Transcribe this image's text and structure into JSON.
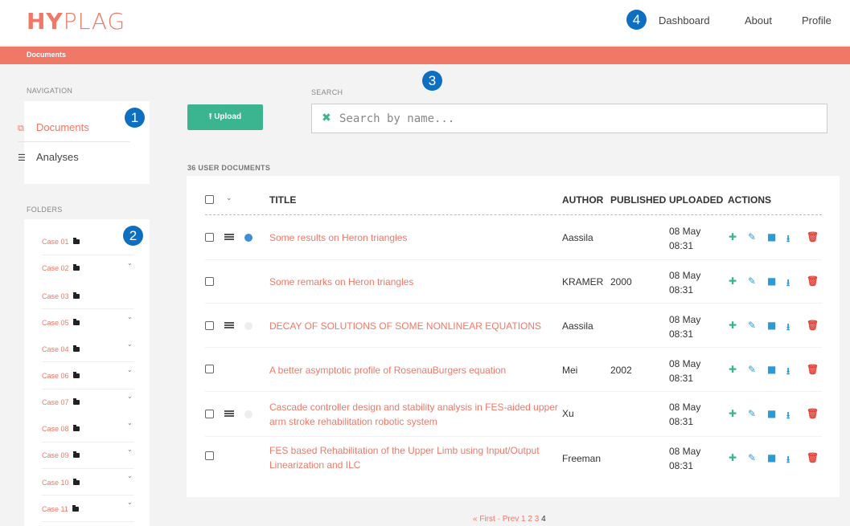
{
  "header": {
    "logo_bold": "HY",
    "logo_light": "PLAG",
    "nav": [
      "Dashboard",
      "About",
      "Profile"
    ]
  },
  "breadcrumb": "Documents",
  "badges": [
    "1",
    "2",
    "3",
    "4"
  ],
  "labels": {
    "navigation": "NAVIGATION",
    "search": "SEARCH",
    "folders": "FOLDERS",
    "doc_count": "36 USER DOCUMENTS"
  },
  "sidebar": {
    "items": [
      {
        "label": "Documents",
        "icon": "documents-icon"
      },
      {
        "label": "Analyses",
        "icon": "list-icon"
      }
    ]
  },
  "folders": [
    "Case 01",
    "Case 02",
    "Case 03",
    "Case 05",
    "Case 04",
    "Case 06",
    "Case 07",
    "Case 08",
    "Case 09",
    "Case 10",
    "Case 11"
  ],
  "toolbar": {
    "upload_label": "Upload",
    "search_placeholder": "Search by name..."
  },
  "table": {
    "headers": [
      "TITLE",
      "AUTHOR",
      "PUBLISHED",
      "UPLOADED",
      "ACTIONS"
    ],
    "rows": [
      {
        "title": "Some results on Heron triangles",
        "author": "Aassila",
        "published": "",
        "uploaded_date": "08 May",
        "uploaded_time": "08:31"
      },
      {
        "title": "Some remarks on Heron triangles",
        "author": "KRAMER",
        "published": "2000",
        "uploaded_date": "08 May",
        "uploaded_time": "08:31"
      },
      {
        "title": "DECAY OF SOLUTIONS OF SOME NONLINEAR EQUATIONS",
        "author": "Aassila",
        "published": "",
        "uploaded_date": "08 May",
        "uploaded_time": "08:31"
      },
      {
        "title": "A better asymptotic profile of RosenauBurgers equation",
        "author": "Mei",
        "published": "2002",
        "uploaded_date": "08 May",
        "uploaded_time": "08:31"
      },
      {
        "title": "Cascade controller design and stability analysis in FES-aided upper arm stroke rehabilitation robotic system",
        "author": "Xu",
        "published": "",
        "uploaded_date": "08 May",
        "uploaded_time": "08:31"
      },
      {
        "title": "FES based Rehabilitation of the Upper Limb using Input/Output Linearization and ILC",
        "author": "Freeman",
        "published": "",
        "uploaded_date": "08 May",
        "uploaded_time": "08:31"
      }
    ]
  },
  "pagination": {
    "first": "« First",
    "sep": "·",
    "prev": "Prev",
    "pages": [
      "1",
      "2",
      "3"
    ],
    "current": "4"
  },
  "colors": {
    "accent": "#f07867",
    "green": "#3ab58f",
    "blue": "#0e6fc1",
    "edit": "#2a9bd6",
    "delete": "#e0433a"
  }
}
